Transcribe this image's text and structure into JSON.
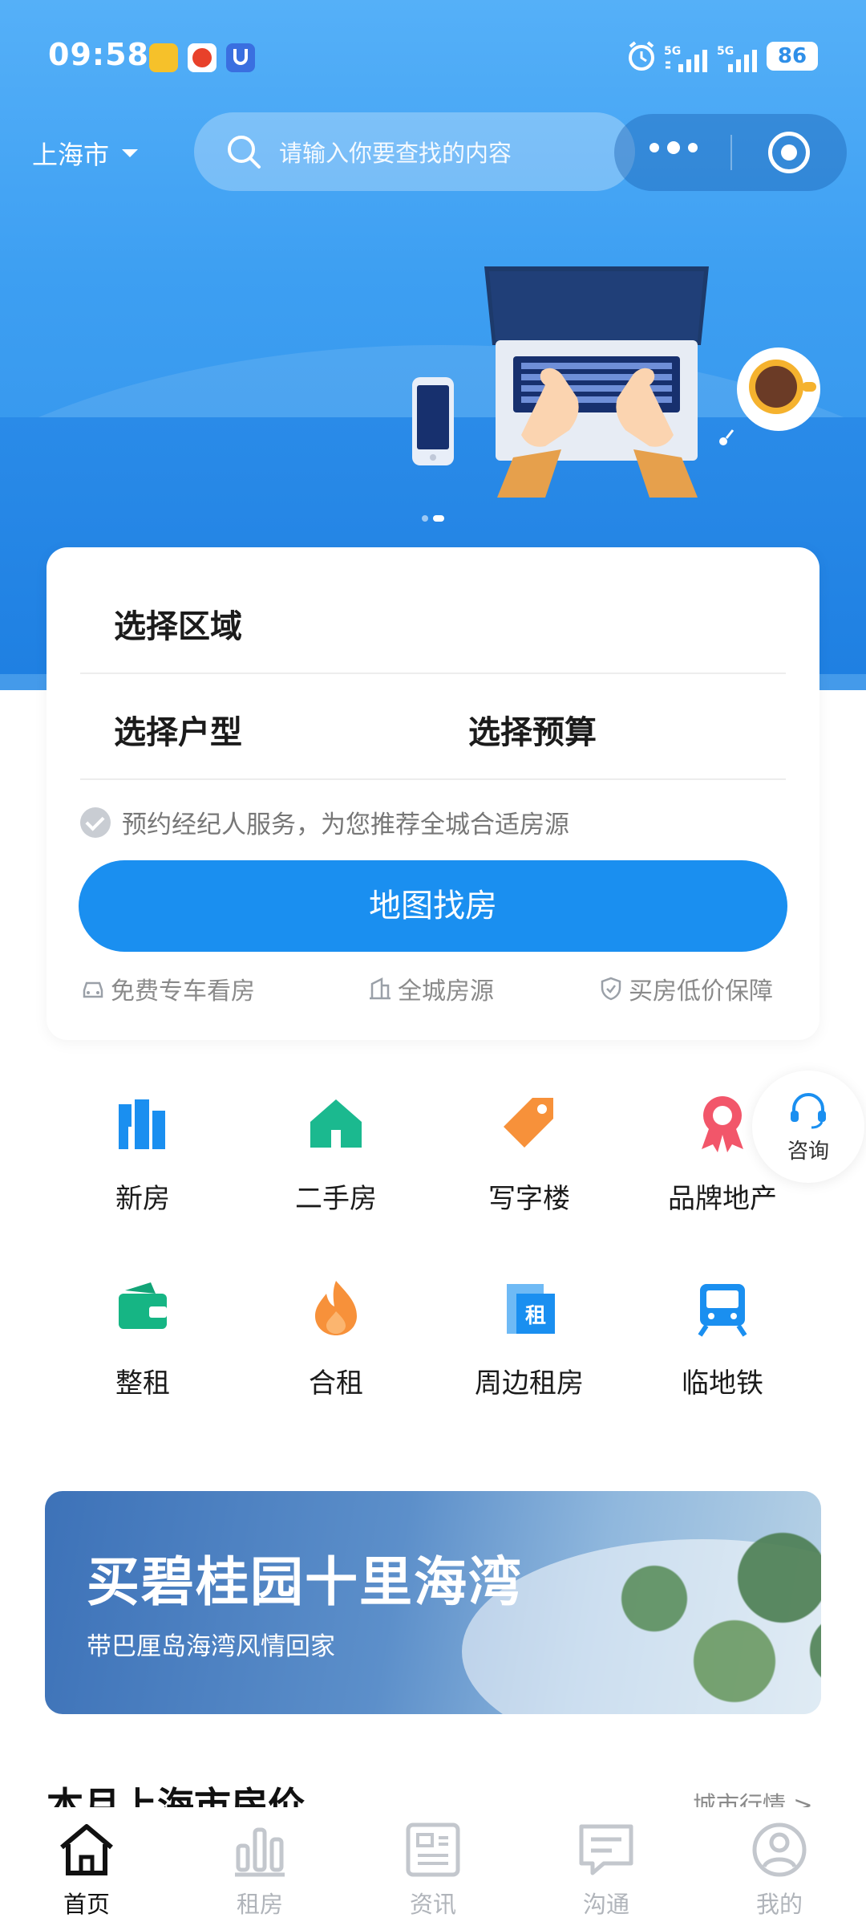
{
  "status_bar": {
    "time": "09:58",
    "network_1": "5G",
    "network_2": "5G",
    "battery": "86"
  },
  "header": {
    "city": "上海市",
    "search_placeholder": "请输入你要查找的内容"
  },
  "search_card": {
    "area_label": "选择区域",
    "layout_label": "选择户型",
    "budget_label": "选择预算",
    "agent_hint": "预约经纪人服务，为您推荐全城合适房源",
    "map_button": "地图找房",
    "features": [
      {
        "label": "免费专车看房",
        "icon": "car-icon"
      },
      {
        "label": "全城房源",
        "icon": "building-icon"
      },
      {
        "label": "买房低价保障",
        "icon": "shield-icon"
      }
    ]
  },
  "consult": {
    "label": "咨询",
    "icon": "headset-icon"
  },
  "categories": [
    {
      "label": "新房",
      "icon": "buildings-icon",
      "color": "#1a8ff0"
    },
    {
      "label": "二手房",
      "icon": "house-icon",
      "color": "#1bb98f"
    },
    {
      "label": "写字楼",
      "icon": "tag-icon",
      "color": "#f7913a"
    },
    {
      "label": "品牌地产",
      "icon": "award-icon",
      "color": "#f2566a"
    },
    {
      "label": "整租",
      "icon": "wallet-icon",
      "color": "#16b584"
    },
    {
      "label": "合租",
      "icon": "flame-icon",
      "color": "#f7913a"
    },
    {
      "label": "周边租房",
      "icon": "rent-building-icon",
      "color": "#1a8ff0"
    },
    {
      "label": "临地铁",
      "icon": "subway-icon",
      "color": "#1a8ff0"
    }
  ],
  "promo": {
    "title": "买碧桂园十里海湾",
    "subtitle": "带巴厘岛海湾风情回家"
  },
  "section": {
    "title": "本月上海市房价",
    "more": "城市行情 >"
  },
  "tabbar": [
    {
      "label": "首页",
      "icon": "home-icon",
      "active": true
    },
    {
      "label": "租房",
      "icon": "chart-icon",
      "active": false
    },
    {
      "label": "资讯",
      "icon": "news-icon",
      "active": false
    },
    {
      "label": "沟通",
      "icon": "chat-icon",
      "active": false
    },
    {
      "label": "我的",
      "icon": "profile-icon",
      "active": false
    }
  ]
}
